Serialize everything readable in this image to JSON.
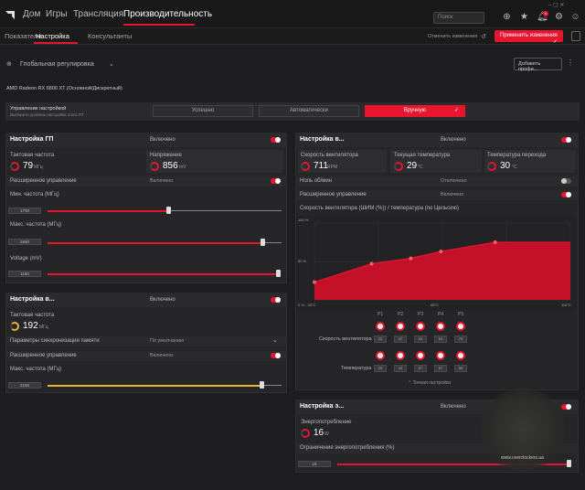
{
  "header": {
    "nav": [
      "Дом",
      "Игры",
      "Трансляция",
      "Производительность"
    ],
    "search_placeholder": "Поиск",
    "notification_count": "1"
  },
  "subnav": {
    "tabs": [
      "Показатели",
      "Настройка",
      "Консультанты"
    ],
    "cancel_label": "Отменить изменения",
    "apply_label": "Применить изменения"
  },
  "global": {
    "title": "Глобальная регулировка",
    "add_profile": "Добавить профи..."
  },
  "gpu_name": "AMD Radeon RX 6800 XT (Основной/Дискретный)",
  "control": {
    "title": "Управление настройкой",
    "subtitle": "Выберите уровень настройки этого ГП",
    "options": [
      "Успешно",
      "Автоматически",
      "Вручную"
    ]
  },
  "gpu_panel": {
    "title": "Настройка ГП",
    "state": "Включено",
    "clock_label": "Тактовая частота",
    "clock_value": "79",
    "clock_unit": "МГц",
    "voltage_label": "Напряжение",
    "voltage_value": "856",
    "voltage_unit": "mV",
    "advanced_label": "Расширенное управление",
    "advanced_state": "Включено",
    "min_freq_label": "Мин. частота (МГц)",
    "min_freq_value": "1700",
    "max_freq_label": "Макс. частота (МГц)",
    "max_freq_value": "2650",
    "voltage_mv_label": "Voltage (mV)",
    "voltage_mv_value": "1150"
  },
  "vram_panel": {
    "title": "Настройка в...",
    "state": "Включено",
    "clock_label": "Тактовая частота",
    "clock_value": "192",
    "clock_unit": "МГц",
    "timing_label": "Параметры синхронизации памяти",
    "timing_value": "По умолчанию",
    "advanced_label": "Расширенное управление",
    "advanced_state": "Включено",
    "max_freq_label": "Макс. частота (МГц)",
    "max_freq_value": "2150"
  },
  "fan_panel": {
    "title": "Настройка в...",
    "state": "Включено",
    "speed_label": "Скорость вентилятора",
    "speed_value": "711",
    "speed_unit": "RPM",
    "temp_label": "Текущая температура",
    "temp_value": "29",
    "temp_unit": "°C",
    "junction_label": "Температура перехода",
    "junction_value": "30",
    "junction_unit": "°C",
    "zero_rpm_label": "Ноль об/мин",
    "zero_rpm_state": "Отключено",
    "advanced_label": "Расширенное управление",
    "advanced_state": "Включено",
    "curve_title": "Скорость вентилятора (ШИМ (%)) / температура (по Цельсию)",
    "y_top": "100 %",
    "y_mid": "50 %",
    "x_start": "0 % - 25°C",
    "x_mid": "65°C",
    "x_end": "110°C",
    "points": [
      "P1",
      "P2",
      "P3",
      "P4",
      "P5"
    ],
    "fan_row_label": "Скорость вентилятора",
    "fan_values": [
      "23",
      "47",
      "54",
      "63",
      "75"
    ],
    "temp_row_label": "Температура",
    "temp_values": [
      "25",
      "44",
      "57",
      "67",
      "85"
    ],
    "fine_tune_label": "Точная настройка"
  },
  "power_panel": {
    "title": "Настройка э...",
    "state": "Включено",
    "consumption_label": "Энергопотребление",
    "consumption_value": "16",
    "consumption_unit": "W",
    "limit_label": "Ограничение энергопотребления (%)",
    "limit_value": "15"
  },
  "watermark": "www.overclockers.ua",
  "chart_data": {
    "type": "area",
    "title": "Скорость вентилятора (ШИМ (%)) / температура (по Цельсию)",
    "x": [
      25,
      44,
      57,
      67,
      85
    ],
    "values": [
      23,
      47,
      54,
      63,
      75
    ],
    "xlabel": "",
    "ylabel": "",
    "ylim": [
      0,
      100
    ],
    "color": "#c5102a"
  }
}
